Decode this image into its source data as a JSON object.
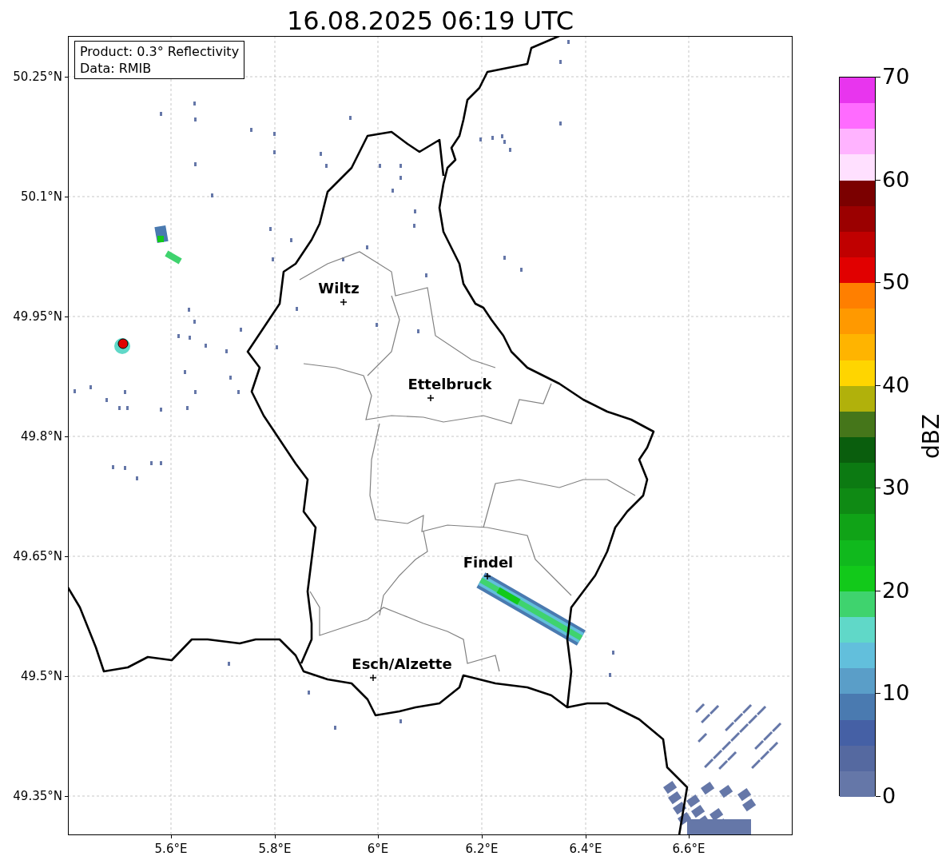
{
  "title": "16.08.2025 06:19 UTC",
  "info_box": [
    "Product: 0.3° Reflectivity",
    "Data: RMIB"
  ],
  "lat_ticks": [
    "50.25°N",
    "50.1°N",
    "49.95°N",
    "49.8°N",
    "49.65°N",
    "49.5°N",
    "49.35°N"
  ],
  "lon_ticks": [
    "5.6°E",
    "5.8°E",
    "6°E",
    "6.2°E",
    "6.4°E",
    "6.6°E"
  ],
  "cities": [
    {
      "name": "Wiltz"
    },
    {
      "name": "Ettelbruck"
    },
    {
      "name": "Findel"
    },
    {
      "name": "Esch/Alzette"
    }
  ],
  "colorbar": {
    "label": "dBZ",
    "ticks": [
      "70",
      "60",
      "50",
      "40",
      "30",
      "20",
      "10",
      "0"
    ],
    "segments": [
      {
        "color": "#e835ee"
      },
      {
        "color": "#ff6bff"
      },
      {
        "color": "#ffb3ff"
      },
      {
        "color": "#ffe0ff"
      },
      {
        "color": "#7b0000"
      },
      {
        "color": "#9b0000"
      },
      {
        "color": "#c00000"
      },
      {
        "color": "#e10000"
      },
      {
        "color": "#ff7f00"
      },
      {
        "color": "#ff9900"
      },
      {
        "color": "#ffb400"
      },
      {
        "color": "#ffd500"
      },
      {
        "color": "#b1b10b"
      },
      {
        "color": "#45761a"
      },
      {
        "color": "#0a5e0d"
      },
      {
        "color": "#0c7a12"
      },
      {
        "color": "#0f8a14"
      },
      {
        "color": "#10a317"
      },
      {
        "color": "#10b91d"
      },
      {
        "color": "#12c91a"
      },
      {
        "color": "#3fd36e"
      },
      {
        "color": "#60d8c8"
      },
      {
        "color": "#62bfdc"
      },
      {
        "color": "#5a9ec8"
      },
      {
        "color": "#4a7ab0"
      },
      {
        "color": "#4560a5"
      },
      {
        "color": "#5569a0"
      },
      {
        "color": "#6577a8"
      }
    ]
  }
}
